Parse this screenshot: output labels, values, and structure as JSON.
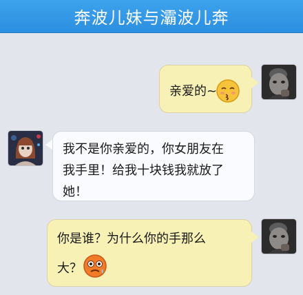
{
  "header": {
    "title": "奔波儿妹与灞波儿奔"
  },
  "messages": [
    {
      "sender": "me",
      "text": "亲爱的~",
      "emoji": "kiss-emoji"
    },
    {
      "sender": "other",
      "line1": "我不是你亲爱的，你女朋友在",
      "line2": "我手里！给我十块钱我就放了",
      "line3": "她！"
    },
    {
      "sender": "me",
      "line1": "你是谁？为什么你的手那么",
      "line2": "大？",
      "emoji": "angry-sweat-emoji"
    }
  ],
  "colors": {
    "header": "#2b8ee0",
    "background": "#e3e5ec",
    "my_bubble": "#f8f1b6",
    "other_bubble": "#fafbfe"
  }
}
